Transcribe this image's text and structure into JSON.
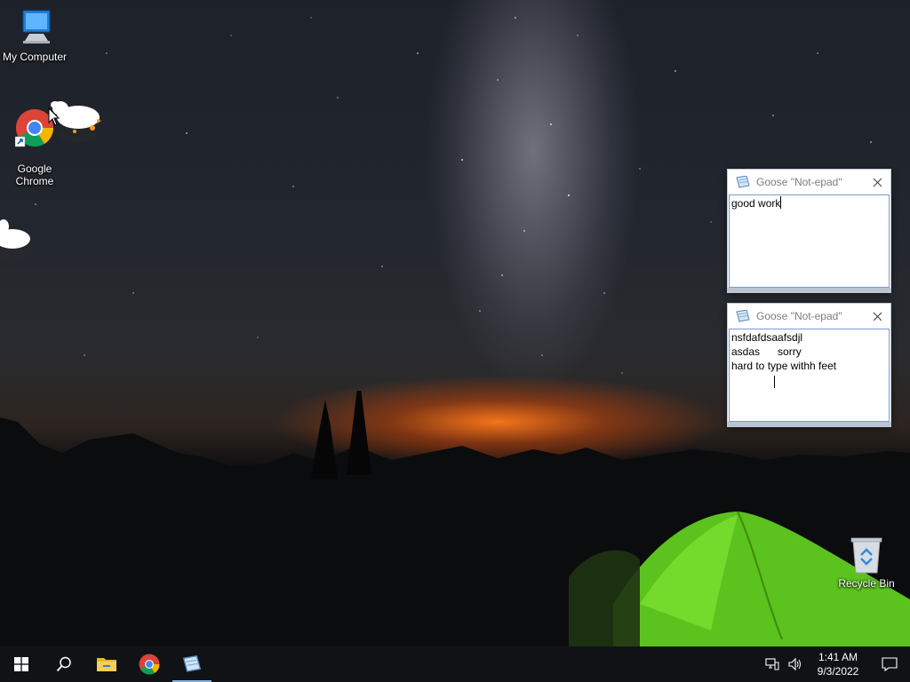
{
  "desktop": {
    "icons": [
      {
        "label": "My Computer",
        "icon": "computer-icon"
      },
      {
        "label": "Google\nChrome",
        "icon": "chrome-icon"
      },
      {
        "label": "Recycle Bin",
        "icon": "recycle-bin-icon"
      }
    ]
  },
  "windows": [
    {
      "title": "Goose \"Not-epad\"",
      "text": "good work",
      "icon": "notepad-icon"
    },
    {
      "title": "Goose \"Not-epad\"",
      "text": "nsfdafdsaafsdjl\nasdas      sorry\nhard to type withh feet",
      "icon": "notepad-icon"
    }
  ],
  "taskbar": {
    "items": [
      "start-icon",
      "search-icon",
      "file-explorer-icon",
      "chrome-icon",
      "notepad-icon"
    ],
    "tray": {
      "time": "1:41 AM",
      "date": "9/3/2022"
    }
  },
  "colors": {
    "taskbar": "#101215",
    "active_indicator": "#7fb2e5",
    "text_box_border": "#7a9ad6"
  }
}
